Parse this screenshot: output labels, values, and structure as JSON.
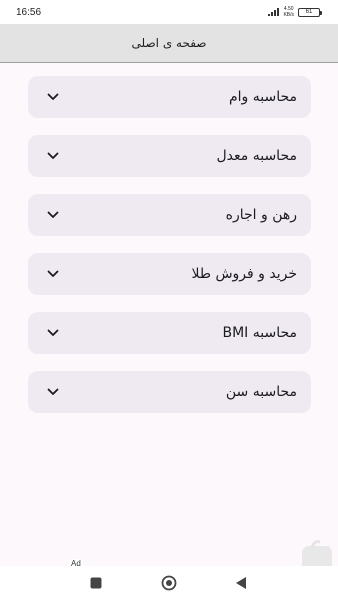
{
  "status_bar": {
    "time": "16:56",
    "net_speed_value": "4.50",
    "net_speed_unit": "KB/s",
    "battery": "61"
  },
  "app_bar": {
    "title": "صفحه ی اصلی"
  },
  "menu": {
    "items": [
      {
        "label": "محاسبه وام"
      },
      {
        "label": "محاسبه معدل"
      },
      {
        "label": "رهن و اجاره"
      },
      {
        "label": "خرید و فروش طلا"
      },
      {
        "label": "محاسبه BMI"
      },
      {
        "label": "محاسبه سن"
      }
    ]
  },
  "ad": {
    "label": "Ad"
  },
  "colors": {
    "background": "#fdf8fc",
    "card": "#efeaf2",
    "app_bar": "#e3e3e3"
  },
  "icons": {
    "chevron": "chevron-down-icon",
    "nav_recents": "square-icon",
    "nav_home": "circle-home-icon",
    "nav_back": "triangle-back-icon"
  }
}
